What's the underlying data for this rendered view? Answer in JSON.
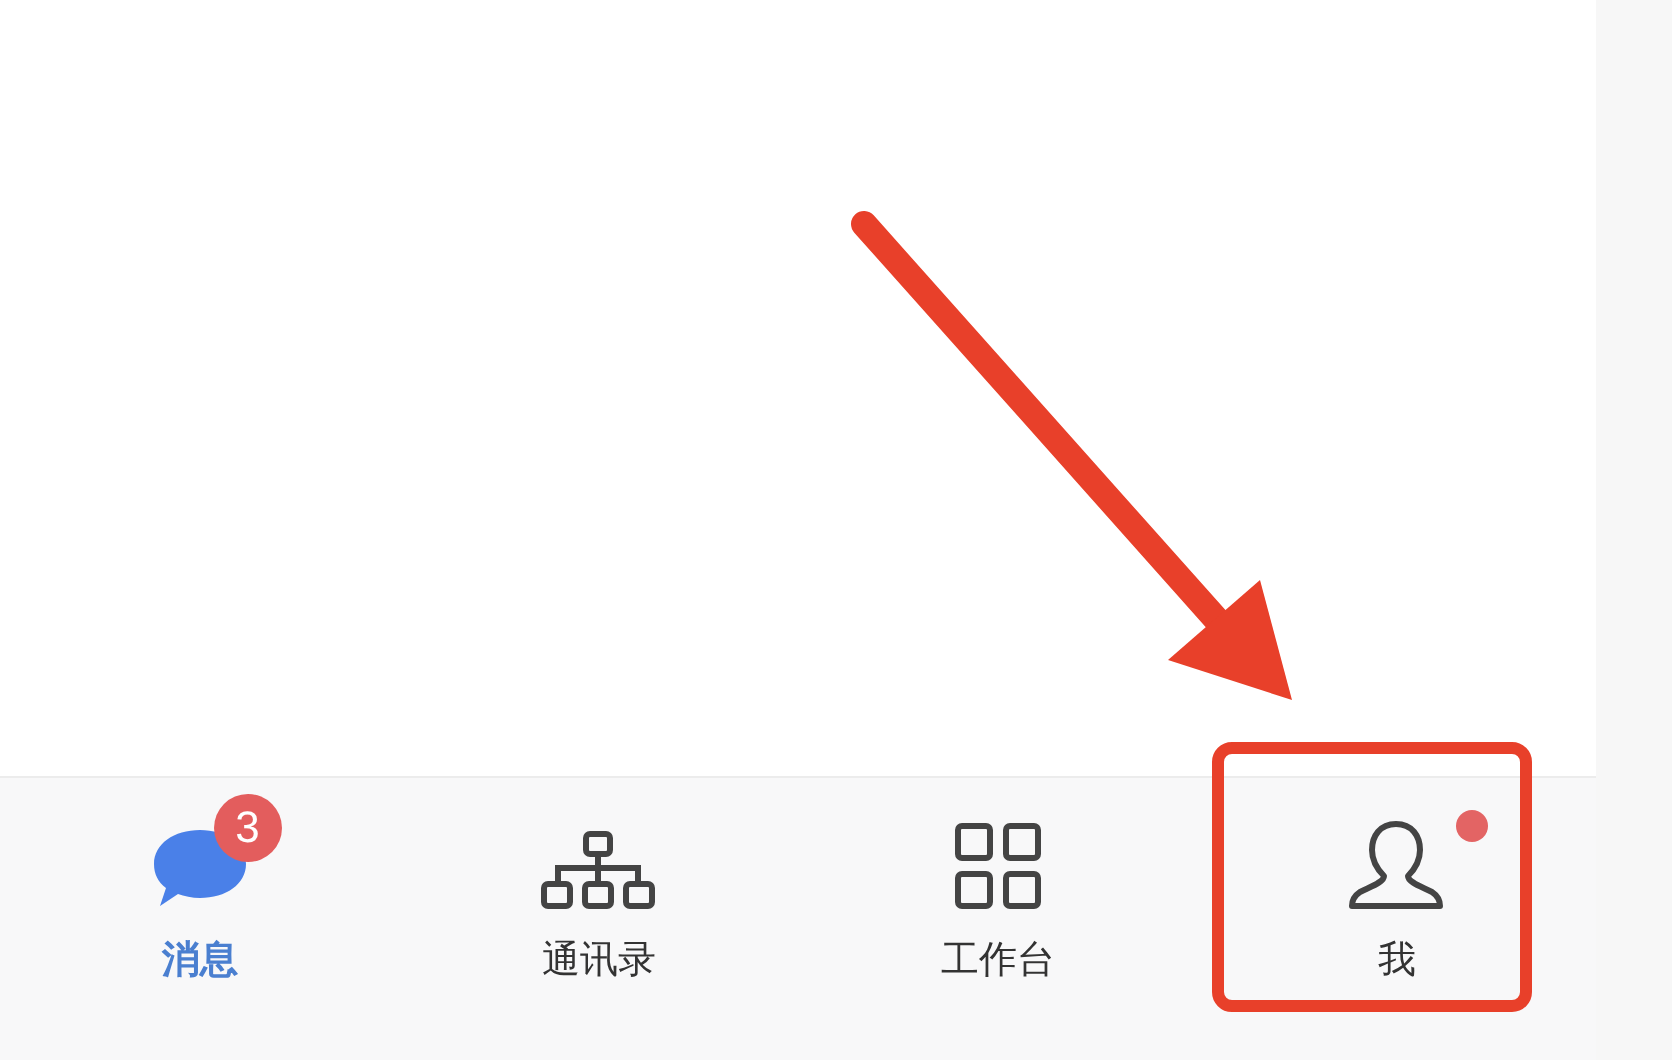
{
  "tab_bar": {
    "tabs": [
      {
        "label": "消息",
        "kind": "chat",
        "selected": true,
        "badge": "3",
        "dot": false
      },
      {
        "label": "通讯录",
        "kind": "org",
        "selected": false,
        "dot": false
      },
      {
        "label": "工作台",
        "kind": "grid",
        "selected": false,
        "dot": false
      },
      {
        "label": "我",
        "kind": "person",
        "selected": false,
        "dot": true
      }
    ]
  }
}
